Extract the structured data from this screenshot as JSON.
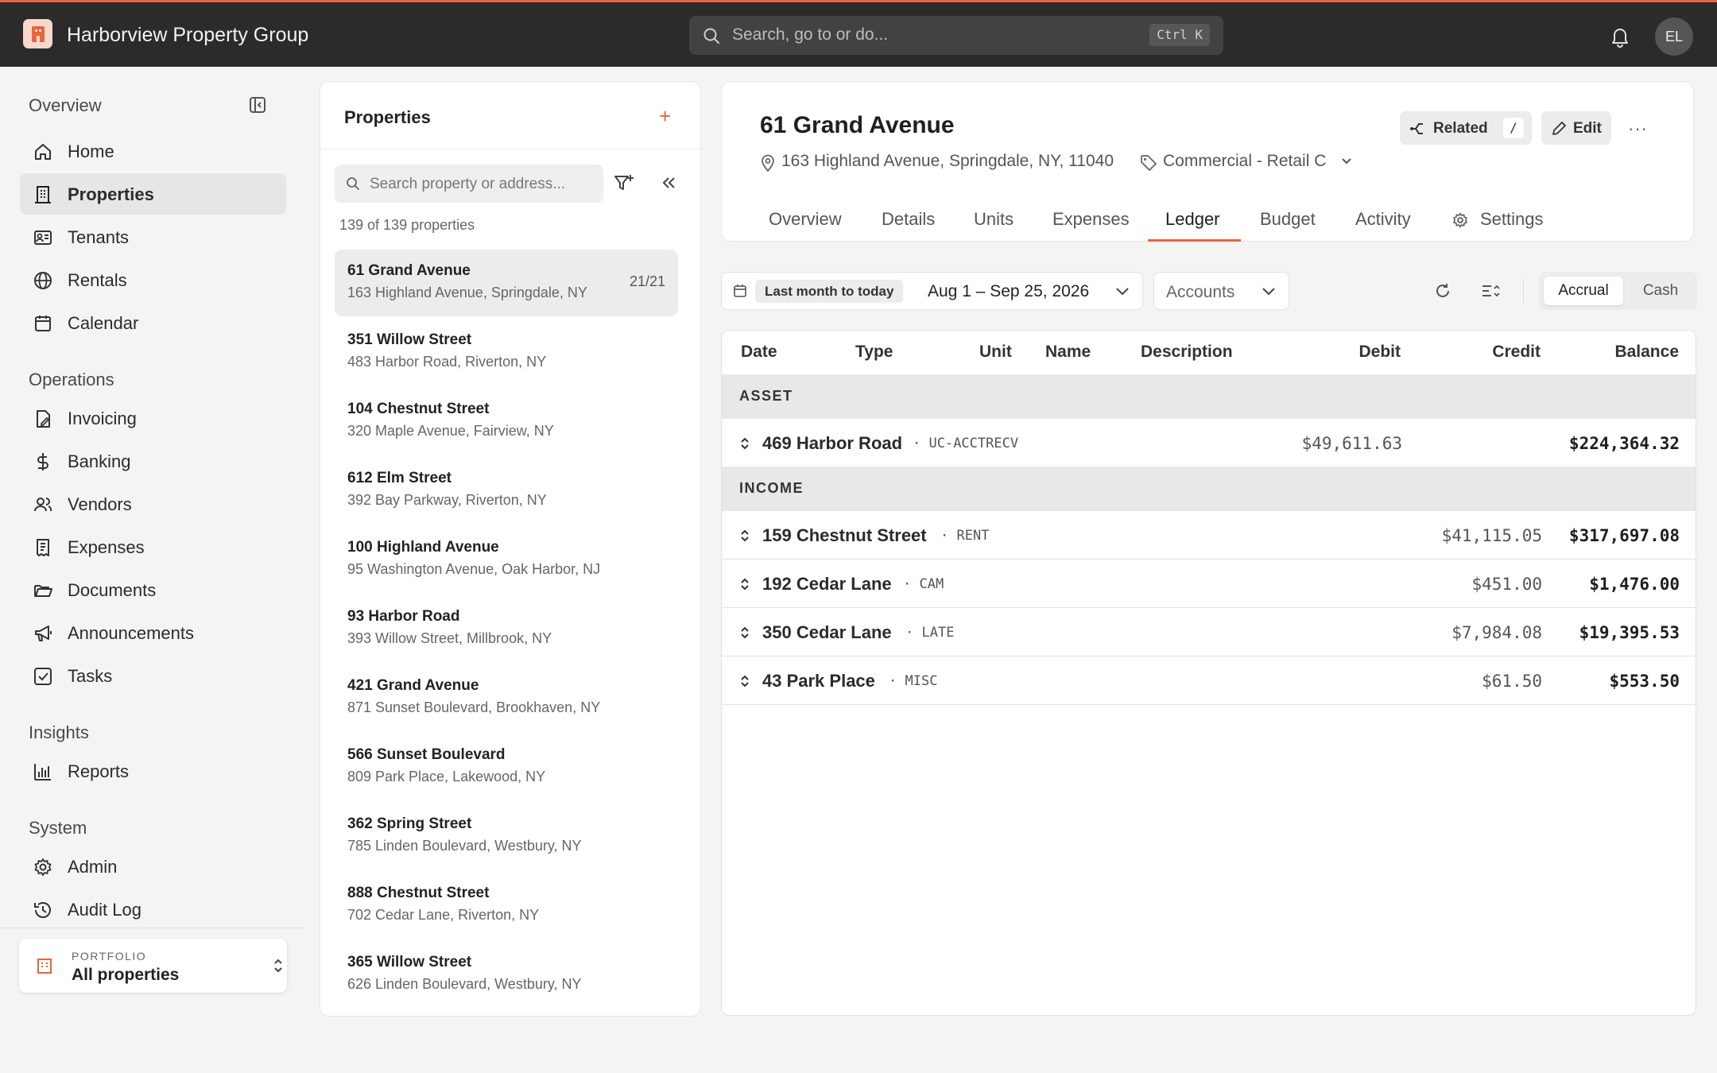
{
  "app": {
    "org_name": "Harborview Property Group",
    "avatar_initials": "EL",
    "accent": "#e8643f"
  },
  "search": {
    "placeholder": "Search, go to or do...",
    "shortcut": "Ctrl K"
  },
  "sidebar": {
    "sections": [
      {
        "title": "Overview",
        "items": [
          {
            "label": "Home",
            "icon": "home-icon"
          },
          {
            "label": "Properties",
            "icon": "building-icon",
            "active": true
          },
          {
            "label": "Tenants",
            "icon": "id-card-icon"
          },
          {
            "label": "Rentals",
            "icon": "globe-icon"
          },
          {
            "label": "Calendar",
            "icon": "calendar-icon"
          }
        ]
      },
      {
        "title": "Operations",
        "items": [
          {
            "label": "Invoicing",
            "icon": "invoice-icon"
          },
          {
            "label": "Banking",
            "icon": "dollar-icon"
          },
          {
            "label": "Vendors",
            "icon": "users-icon"
          },
          {
            "label": "Expenses",
            "icon": "receipt-icon"
          },
          {
            "label": "Documents",
            "icon": "folder-icon"
          },
          {
            "label": "Announcements",
            "icon": "megaphone-icon"
          },
          {
            "label": "Tasks",
            "icon": "checkbox-icon"
          }
        ]
      },
      {
        "title": "Insights",
        "items": [
          {
            "label": "Reports",
            "icon": "bar-chart-icon"
          }
        ]
      },
      {
        "title": "System",
        "items": [
          {
            "label": "Admin",
            "icon": "gear-icon"
          },
          {
            "label": "Audit Log",
            "icon": "history-icon"
          }
        ]
      }
    ],
    "portfolio": {
      "kicker": "PORTFOLIO",
      "value": "All properties"
    }
  },
  "properties_panel": {
    "title": "Properties",
    "search_placeholder": "Search property or address...",
    "count_text": "139 of 139 properties",
    "items": [
      {
        "name": "61 Grand Avenue",
        "address": "163 Highland Avenue, Springdale, NY",
        "units": "21/21",
        "active": true
      },
      {
        "name": "351 Willow Street",
        "address": "483 Harbor Road, Riverton, NY"
      },
      {
        "name": "104 Chestnut Street",
        "address": "320 Maple Avenue, Fairview, NY"
      },
      {
        "name": "612 Elm Street",
        "address": "392 Bay Parkway, Riverton, NY"
      },
      {
        "name": "100 Highland Avenue",
        "address": "95 Washington Avenue, Oak Harbor, NJ"
      },
      {
        "name": "93 Harbor Road",
        "address": "393 Willow Street, Millbrook, NY"
      },
      {
        "name": "421 Grand Avenue",
        "address": "871 Sunset Boulevard, Brookhaven, NY"
      },
      {
        "name": "566 Sunset Boulevard",
        "address": "809 Park Place, Lakewood, NY"
      },
      {
        "name": "362 Spring Street",
        "address": "785 Linden Boulevard, Westbury, NY"
      },
      {
        "name": "888 Chestnut Street",
        "address": "702 Cedar Lane, Riverton, NY"
      },
      {
        "name": "365 Willow Street",
        "address": "626 Linden Boulevard, Westbury, NY"
      }
    ]
  },
  "detail": {
    "title": "61 Grand Avenue",
    "address": "163 Highland Avenue, Springdale, NY, 11040",
    "type": "Commercial - Retail C",
    "related_label": "Related",
    "related_key": "/",
    "edit_label": "Edit",
    "more_label": "···",
    "tabs": [
      "Overview",
      "Details",
      "Units",
      "Expenses",
      "Ledger",
      "Budget",
      "Activity",
      "Settings"
    ],
    "active_tab": "Ledger"
  },
  "toolbar": {
    "preset": "Last month to today",
    "range": "Aug 1 – Sep 25, 2026",
    "accounts": "Accounts",
    "basis_options": [
      "Accrual",
      "Cash"
    ],
    "basis_selected": "Accrual"
  },
  "ledger": {
    "headers": [
      "Date",
      "Type",
      "Unit",
      "Name",
      "Description",
      "Debit",
      "Credit",
      "Balance"
    ],
    "groups": [
      {
        "title": "ASSET",
        "rows": [
          {
            "name": "469 Harbor Road",
            "code": "UC-ACCTRECV",
            "debit": "$49,611.63",
            "credit": "",
            "balance": "$224,364.32"
          }
        ]
      },
      {
        "title": "INCOME",
        "rows": [
          {
            "name": "159 Chestnut Street",
            "code": "RENT",
            "debit": "",
            "credit": "$41,115.05",
            "balance": "$317,697.08"
          },
          {
            "name": "192 Cedar Lane",
            "code": "CAM",
            "debit": "",
            "credit": "$451.00",
            "balance": "$1,476.00"
          },
          {
            "name": "350 Cedar Lane",
            "code": "LATE",
            "debit": "",
            "credit": "$7,984.08",
            "balance": "$19,395.53"
          },
          {
            "name": "43 Park Place",
            "code": "MISC",
            "debit": "",
            "credit": "$61.50",
            "balance": "$553.50"
          }
        ]
      }
    ]
  }
}
